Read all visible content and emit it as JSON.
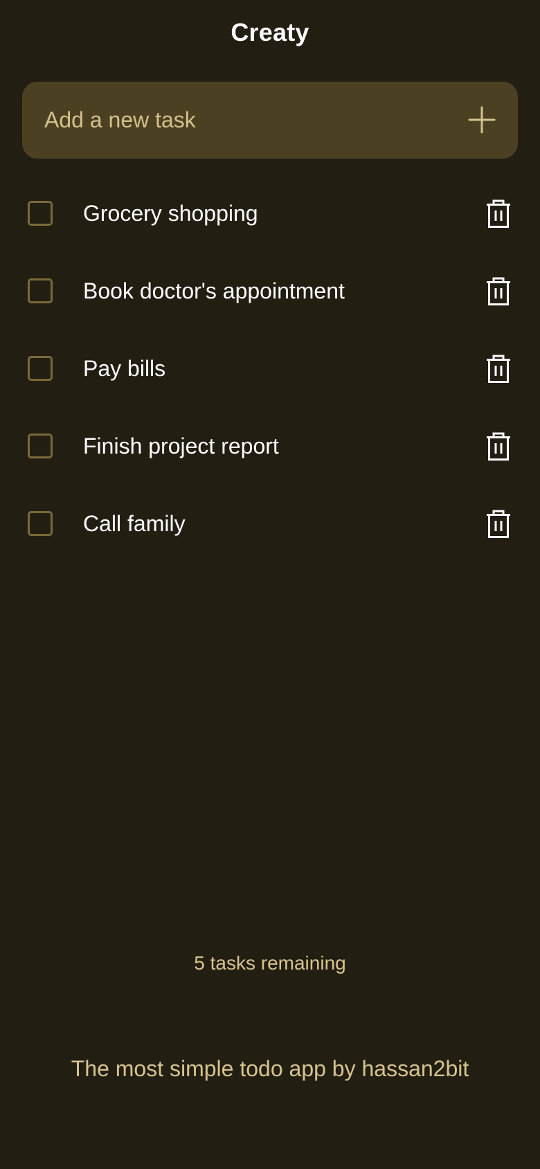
{
  "app": {
    "title": "Creaty"
  },
  "new_task": {
    "placeholder": "Add a new task",
    "value": "",
    "add_icon": "plus-icon"
  },
  "tasks": [
    {
      "label": "Grocery shopping",
      "completed": false
    },
    {
      "label": "Book doctor's appointment",
      "completed": false
    },
    {
      "label": "Pay bills",
      "completed": false
    },
    {
      "label": "Finish project report",
      "completed": false
    },
    {
      "label": "Call family",
      "completed": false
    }
  ],
  "status": {
    "remaining_text": "5 tasks remaining"
  },
  "footer": {
    "credit": "The most simple todo app by hassan2bit"
  },
  "icons": {
    "delete": "trash-icon",
    "add": "plus-icon"
  },
  "colors": {
    "background": "#231e12",
    "input_background": "#4b4122",
    "accent_text": "#d6c48f",
    "checkbox_border": "#7a6a3a",
    "primary_text": "#ffffff"
  }
}
